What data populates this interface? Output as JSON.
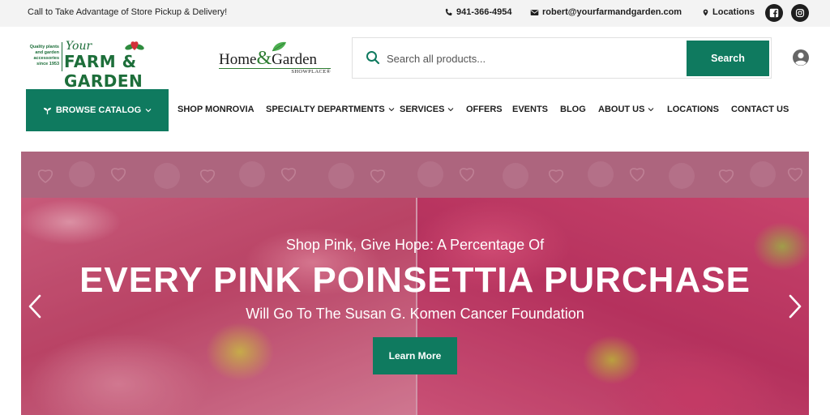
{
  "topbar": {
    "message": "Call to Take Advantage of Store Pickup & Delivery!",
    "phone": "941-366-4954",
    "email": "robert@yourfarmandgarden.com",
    "locations": "Locations",
    "social": [
      "facebook-icon",
      "instagram-icon"
    ]
  },
  "logo": {
    "tagline": [
      "Quality plants",
      "and garden",
      "accessories",
      "since 1953"
    ],
    "your": "Your",
    "name": "FARM & GARDEN",
    "partner_home": "Home",
    "partner_amp": "&",
    "partner_garden": "Garden",
    "partner_sub": "SHOWPLACE®"
  },
  "search": {
    "placeholder": "Search all products...",
    "button": "Search"
  },
  "nav": {
    "browse": "BROWSE CATALOG",
    "items": [
      {
        "label": "SHOP MONROVIA",
        "dropdown": false
      },
      {
        "label": "SPECIALTY DEPARTMENTS",
        "dropdown": true
      },
      {
        "label": "SERVICES",
        "dropdown": true
      },
      {
        "label": "OFFERS",
        "dropdown": false
      },
      {
        "label": "EVENTS",
        "dropdown": false
      },
      {
        "label": "BLOG",
        "dropdown": false
      },
      {
        "label": "ABOUT US",
        "dropdown": true
      },
      {
        "label": "LOCATIONS",
        "dropdown": false
      },
      {
        "label": "CONTACT US",
        "dropdown": false
      }
    ]
  },
  "hero": {
    "subtitle": "Shop Pink, Give Hope: A Percentage Of",
    "headline": "EVERY PINK POINSETTIA PURCHASE",
    "subtitle2": "Will Go To The Susan G. Komen Cancer Foundation",
    "cta": "Learn More"
  },
  "colors": {
    "brand_green": "#0f7a5f",
    "logo_green": "#1d6e3a",
    "topbar_bg": "#f3f3f3",
    "hero_pink": "#c94c72"
  }
}
